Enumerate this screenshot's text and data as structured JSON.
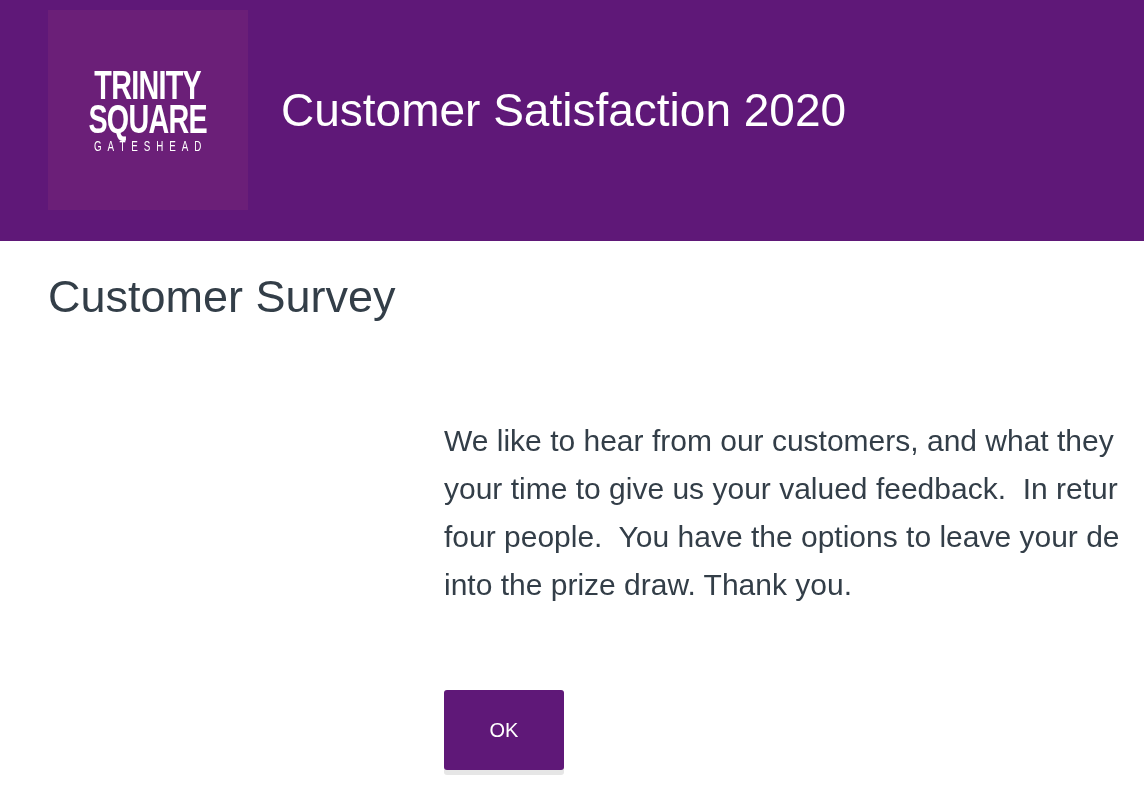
{
  "header": {
    "logo": {
      "lines": [
        "TRINITY",
        "SQUARE",
        "GATESHEAD"
      ]
    },
    "title": "Customer Satisfaction 2020"
  },
  "page": {
    "heading": "Customer Survey",
    "intro": {
      "lines": [
        "We like to hear from our customers, and what they",
        "your time to give us your valued feedback.  In retur",
        "four people.  You have the options to leave your de",
        "into the prize draw. Thank you."
      ]
    },
    "buttons": [
      {
        "label": "OK",
        "kind": "primary"
      }
    ]
  }
}
